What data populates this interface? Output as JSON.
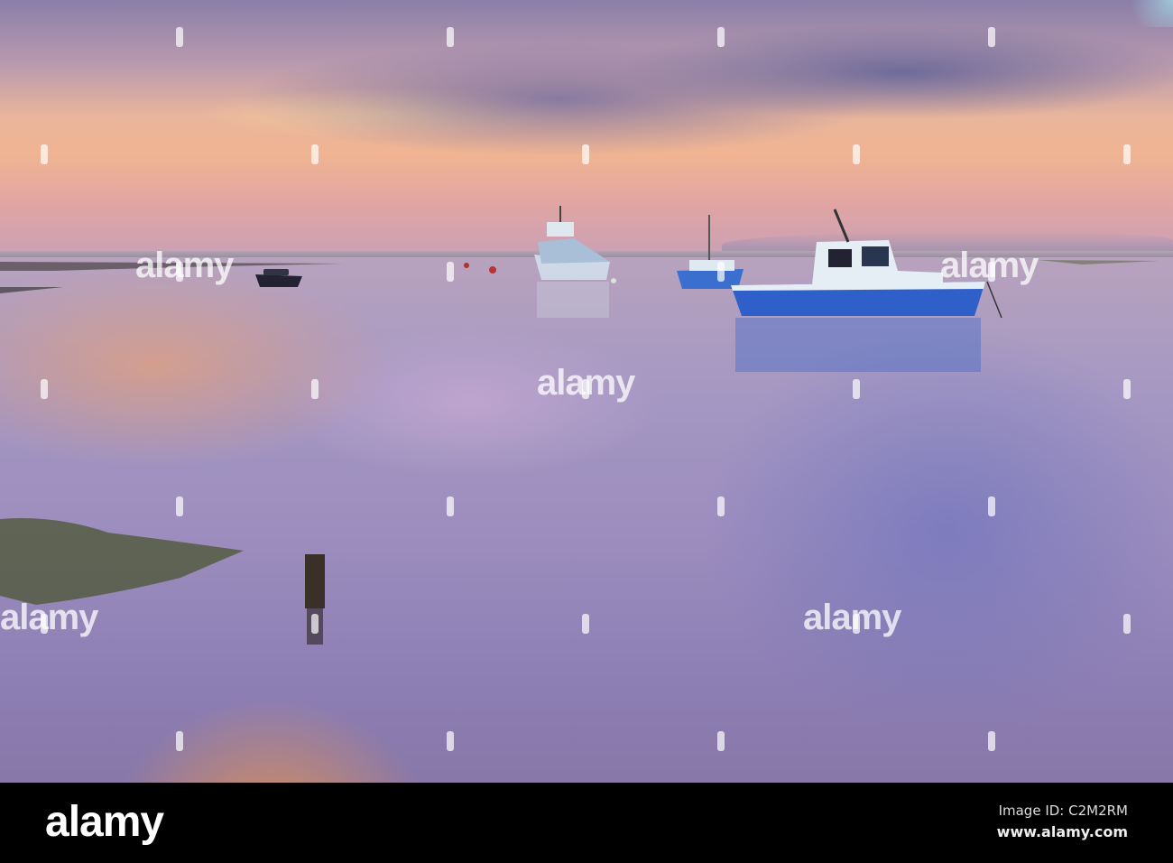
{
  "photo": {
    "subject": "boats-moored-at-sunset",
    "watermark_text": "alamy"
  },
  "footer": {
    "logo": "alamy",
    "image_id": "Image ID: C2M2RM",
    "site_url": "www.alamy.com"
  },
  "colors": {
    "sky_top": "#8a7fa8",
    "sky_glow": "#f0b492",
    "water": "#9b8cbd",
    "reflection": "#f09646",
    "boat_blue": "#2f5fc8",
    "cabin_white": "#e6eef5",
    "bar": "#000000"
  }
}
